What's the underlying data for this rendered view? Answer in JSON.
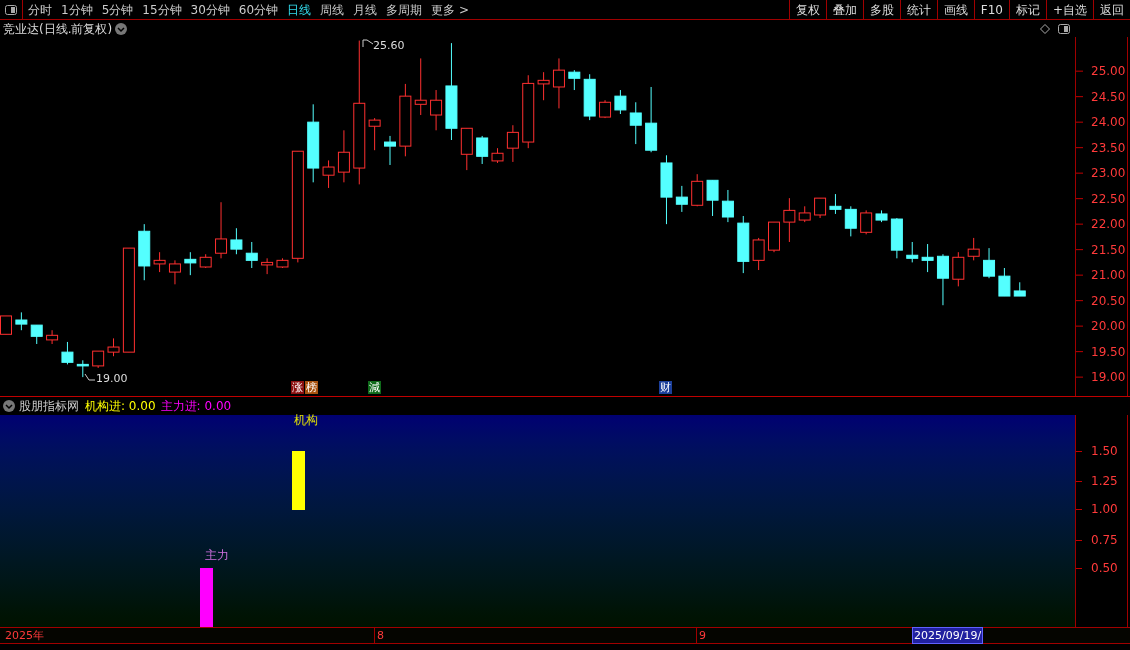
{
  "toolbar": {
    "periods": [
      {
        "label": "分时",
        "selected": false
      },
      {
        "label": "1分钟",
        "selected": false
      },
      {
        "label": "5分钟",
        "selected": false
      },
      {
        "label": "15分钟",
        "selected": false
      },
      {
        "label": "30分钟",
        "selected": false
      },
      {
        "label": "60分钟",
        "selected": false
      },
      {
        "label": "日线",
        "selected": true
      },
      {
        "label": "周线",
        "selected": false
      },
      {
        "label": "月线",
        "selected": false
      },
      {
        "label": "多周期",
        "selected": false
      },
      {
        "label": "更多 >",
        "selected": false
      }
    ],
    "actions": [
      "复权",
      "叠加",
      "多股",
      "统计",
      "画线",
      "F10",
      "标记",
      "+自选",
      "返回"
    ]
  },
  "chart": {
    "title": "竞业达(日线.前复权)",
    "chart_data": {
      "type": "candlestick",
      "ohlc": [
        [
          19.84,
          20.2,
          19.84,
          20.2
        ],
        [
          20.12,
          20.27,
          19.92,
          20.04
        ],
        [
          20.02,
          20.02,
          19.65,
          19.8
        ],
        [
          19.73,
          19.92,
          19.65,
          19.82
        ],
        [
          19.49,
          19.69,
          19.25,
          19.29
        ],
        [
          19.25,
          19.33,
          19.0,
          19.22
        ],
        [
          19.22,
          19.51,
          19.18,
          19.51
        ],
        [
          19.49,
          19.76,
          19.41,
          19.59
        ],
        [
          19.49,
          21.53,
          19.49,
          21.53
        ],
        [
          21.86,
          22.0,
          20.9,
          21.18
        ],
        [
          21.22,
          21.45,
          21.06,
          21.29
        ],
        [
          21.06,
          21.29,
          20.82,
          21.22
        ],
        [
          21.31,
          21.45,
          21.0,
          21.24
        ],
        [
          21.16,
          21.41,
          21.14,
          21.35
        ],
        [
          21.43,
          22.43,
          21.33,
          21.71
        ],
        [
          21.69,
          21.92,
          21.41,
          21.51
        ],
        [
          21.43,
          21.65,
          21.14,
          21.29
        ],
        [
          21.2,
          21.33,
          21.02,
          21.25
        ],
        [
          21.16,
          21.33,
          21.14,
          21.29
        ],
        [
          21.33,
          23.43,
          21.25,
          23.43
        ],
        [
          24.0,
          24.35,
          22.82,
          23.1
        ],
        [
          22.96,
          23.25,
          22.71,
          23.12
        ],
        [
          23.02,
          23.84,
          22.82,
          23.41
        ],
        [
          23.1,
          25.6,
          22.78,
          24.37
        ],
        [
          23.92,
          24.08,
          23.45,
          24.04
        ],
        [
          23.61,
          23.73,
          23.16,
          23.53
        ],
        [
          23.53,
          24.75,
          23.33,
          24.51
        ],
        [
          24.35,
          25.25,
          24.14,
          24.43
        ],
        [
          24.14,
          24.63,
          23.84,
          24.43
        ],
        [
          24.71,
          25.55,
          23.65,
          23.88
        ],
        [
          23.37,
          23.88,
          23.06,
          23.88
        ],
        [
          23.69,
          23.73,
          23.18,
          23.33
        ],
        [
          23.24,
          23.49,
          23.2,
          23.39
        ],
        [
          23.49,
          23.94,
          23.22,
          23.8
        ],
        [
          23.61,
          24.92,
          23.49,
          24.76
        ],
        [
          24.75,
          24.98,
          24.43,
          24.82
        ],
        [
          24.69,
          25.25,
          24.27,
          25.02
        ],
        [
          24.98,
          25.02,
          24.63,
          24.86
        ],
        [
          24.84,
          24.94,
          24.04,
          24.12
        ],
        [
          24.1,
          24.43,
          24.08,
          24.39
        ],
        [
          24.51,
          24.63,
          24.16,
          24.24
        ],
        [
          24.18,
          24.39,
          23.57,
          23.94
        ],
        [
          23.98,
          24.69,
          23.41,
          23.45
        ],
        [
          23.2,
          23.35,
          22.0,
          22.53
        ],
        [
          22.53,
          22.75,
          22.24,
          22.39
        ],
        [
          22.37,
          22.98,
          22.35,
          22.84
        ],
        [
          22.86,
          22.86,
          22.16,
          22.47
        ],
        [
          22.45,
          22.67,
          22.04,
          22.14
        ],
        [
          22.02,
          22.16,
          21.04,
          21.27
        ],
        [
          21.29,
          21.73,
          21.1,
          21.69
        ],
        [
          21.49,
          22.04,
          21.45,
          22.04
        ],
        [
          22.04,
          22.51,
          21.65,
          22.27
        ],
        [
          22.08,
          22.35,
          22.04,
          22.22
        ],
        [
          22.18,
          22.51,
          22.12,
          22.51
        ],
        [
          22.35,
          22.59,
          22.2,
          22.29
        ],
        [
          22.29,
          22.35,
          21.76,
          21.92
        ],
        [
          21.84,
          22.27,
          21.8,
          22.22
        ],
        [
          22.2,
          22.27,
          22.04,
          22.08
        ],
        [
          22.1,
          22.12,
          21.33,
          21.49
        ],
        [
          21.39,
          21.65,
          21.25,
          21.33
        ],
        [
          21.35,
          21.61,
          21.06,
          21.29
        ],
        [
          21.37,
          21.41,
          20.41,
          20.94
        ],
        [
          20.92,
          21.45,
          20.78,
          21.35
        ],
        [
          21.37,
          21.73,
          21.29,
          21.51
        ],
        [
          21.29,
          21.53,
          20.94,
          20.98
        ],
        [
          20.98,
          21.14,
          20.59,
          20.59
        ],
        [
          20.69,
          20.86,
          20.59,
          20.59
        ]
      ],
      "ylim": [
        18.63,
        25.67
      ],
      "yticks": [
        {
          "value": 25,
          "label": "25.00"
        },
        {
          "value": 24.5,
          "label": "24.50"
        },
        {
          "value": 24,
          "label": "24.00"
        },
        {
          "value": 23.5,
          "label": "23.50"
        },
        {
          "value": 23,
          "label": "23.00"
        },
        {
          "value": 22.5,
          "label": "22.50"
        },
        {
          "value": 22,
          "label": "22.00"
        },
        {
          "value": 21.5,
          "label": "21.50"
        },
        {
          "value": 21,
          "label": "21.00"
        },
        {
          "value": 20.5,
          "label": "20.50"
        },
        {
          "value": 20,
          "label": "20.00"
        },
        {
          "value": 19.5,
          "label": "19.50"
        },
        {
          "value": 19,
          "label": "19.00"
        }
      ]
    },
    "high_label": "25.60",
    "low_label": "19.00",
    "event_tags": [
      {
        "label": "涨",
        "color": "#8b1010"
      },
      {
        "label": "榜",
        "color": "#a8520f"
      },
      {
        "label": "減",
        "color": "#0f6a1a"
      },
      {
        "label": "财",
        "color": "#1c3f9a"
      }
    ]
  },
  "indicator": {
    "name": "股朋指标网",
    "readouts": [
      {
        "label": "机构进:",
        "value": "0.00",
        "color": "#ffff00"
      },
      {
        "label": "主力进:",
        "value": "0.00",
        "color": "#ff00ff"
      }
    ],
    "bar_labels": [
      "机构",
      "主力"
    ],
    "axis": [
      "1.50",
      "1.25",
      "1.00",
      "0.75",
      "0.50"
    ]
  },
  "timeline": {
    "labels": [
      "2025年",
      "8",
      "9"
    ],
    "cursor_date": "2025/09/19/"
  }
}
